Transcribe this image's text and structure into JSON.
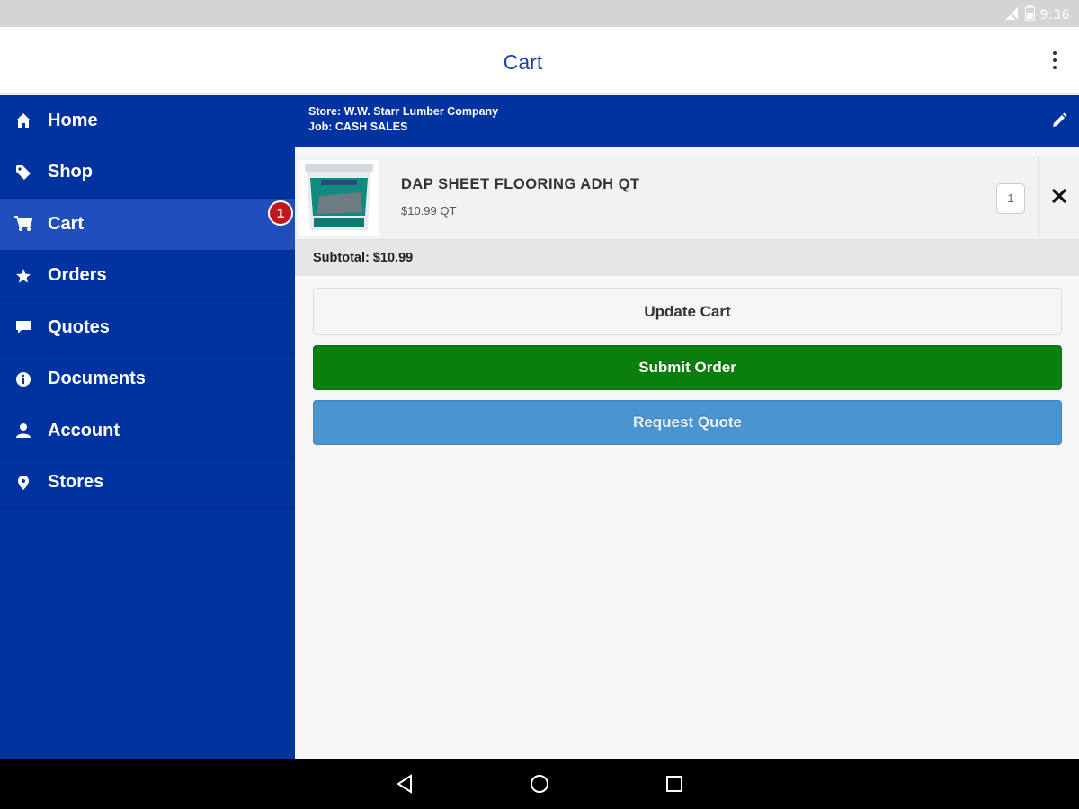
{
  "status_bar": {
    "time": "9:36"
  },
  "app_bar": {
    "title": "Cart"
  },
  "sidebar": {
    "items": [
      {
        "label": "Home",
        "icon": "home-icon"
      },
      {
        "label": "Shop",
        "icon": "tag-icon"
      },
      {
        "label": "Cart",
        "icon": "cart-icon",
        "active": true,
        "badge": "1"
      },
      {
        "label": "Orders",
        "icon": "star-icon"
      },
      {
        "label": "Quotes",
        "icon": "chat-icon"
      },
      {
        "label": "Documents",
        "icon": "info-icon"
      },
      {
        "label": "Account",
        "icon": "person-icon"
      },
      {
        "label": "Stores",
        "icon": "location-pin-icon"
      }
    ]
  },
  "store_bar": {
    "store": "Store: W.W. Starr Lumber Company",
    "job": "Job: CASH SALES"
  },
  "cart": {
    "items": [
      {
        "name": "DAP SHEET FLOORING ADH QT",
        "price": "$10.99 QT",
        "quantity": "1"
      }
    ],
    "subtotal": "Subtotal: $10.99"
  },
  "actions": {
    "update_label": "Update Cart",
    "submit_label": "Submit Order",
    "quote_label": "Request Quote"
  },
  "colors": {
    "brand_blue": "#0033a0",
    "active_nav": "#1e4fbd",
    "submit_green": "#0b7f0b",
    "quote_blue": "#4a94cf",
    "badge_red": "#c0181c"
  }
}
